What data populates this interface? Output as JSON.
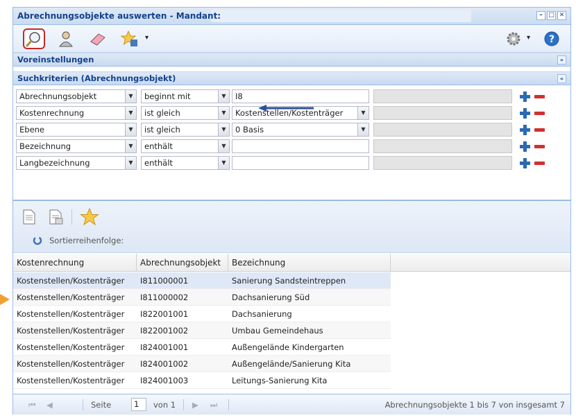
{
  "window": {
    "title": "Abrechnungsobjekte auswerten - Mandant:",
    "controls": [
      "minimize-icon",
      "maximize-icon",
      "close-icon"
    ]
  },
  "toolbar": {
    "buttons": [
      "search-icon",
      "user-icon",
      "eraser-icon",
      "favorites-icon"
    ],
    "dropdown_caret": "▾",
    "settings_caret": "▾"
  },
  "sections": {
    "presets": "Voreinstellungen",
    "criteria": "Suchkriterien (Abrechnungsobjekt)"
  },
  "criteria": [
    {
      "field": "Abrechnungsobjekt",
      "op": "beginnt mit",
      "value": "I8",
      "value_is_combo": false
    },
    {
      "field": "Kostenrechnung",
      "op": "ist gleich",
      "value": "Kostenstellen/Kostenträger",
      "value_is_combo": true
    },
    {
      "field": "Ebene",
      "op": "ist gleich",
      "value": "0 Basis",
      "value_is_combo": true
    },
    {
      "field": "Bezeichnung",
      "op": "enthält",
      "value": "",
      "value_is_combo": false
    },
    {
      "field": "Langbezeichnung",
      "op": "enthält",
      "value": "",
      "value_is_combo": false
    }
  ],
  "results": {
    "sort_label": "Sortierreihenfolge:",
    "columns": [
      "Kostenrechnung",
      "Abrechnungsobjekt",
      "Bezeichnung"
    ],
    "rows": [
      [
        "Kostenstellen/Kostenträger",
        "I811000001",
        "Sanierung Sandsteintreppen"
      ],
      [
        "Kostenstellen/Kostenträger",
        "I811000002",
        "Dachsanierung Süd"
      ],
      [
        "Kostenstellen/Kostenträger",
        "I822001001",
        "Dachsanierung"
      ],
      [
        "Kostenstellen/Kostenträger",
        "I822001002",
        "Umbau Gemeindehaus"
      ],
      [
        "Kostenstellen/Kostenträger",
        "I824001001",
        "Außengelände Kindergarten"
      ],
      [
        "Kostenstellen/Kostenträger",
        "I824001002",
        "Außengelände/Sanierung Kita"
      ],
      [
        "Kostenstellen/Kostenträger",
        "I824001003",
        "Leitungs-Sanierung Kita"
      ]
    ],
    "selected_row": 0
  },
  "pager": {
    "page_label": "Seite",
    "page_value": "1",
    "of_label": "von 1",
    "summary": "Abrechnungsobjekte 1 bis 7 von insgesamt 7"
  },
  "colors": {
    "accent": "#15428b",
    "highlight_border": "#c62828",
    "plus": "#2b6ab5",
    "minus": "#d32f2f",
    "annotation_arrow": "#2e4f9c",
    "row_marker": "#f0a030"
  }
}
